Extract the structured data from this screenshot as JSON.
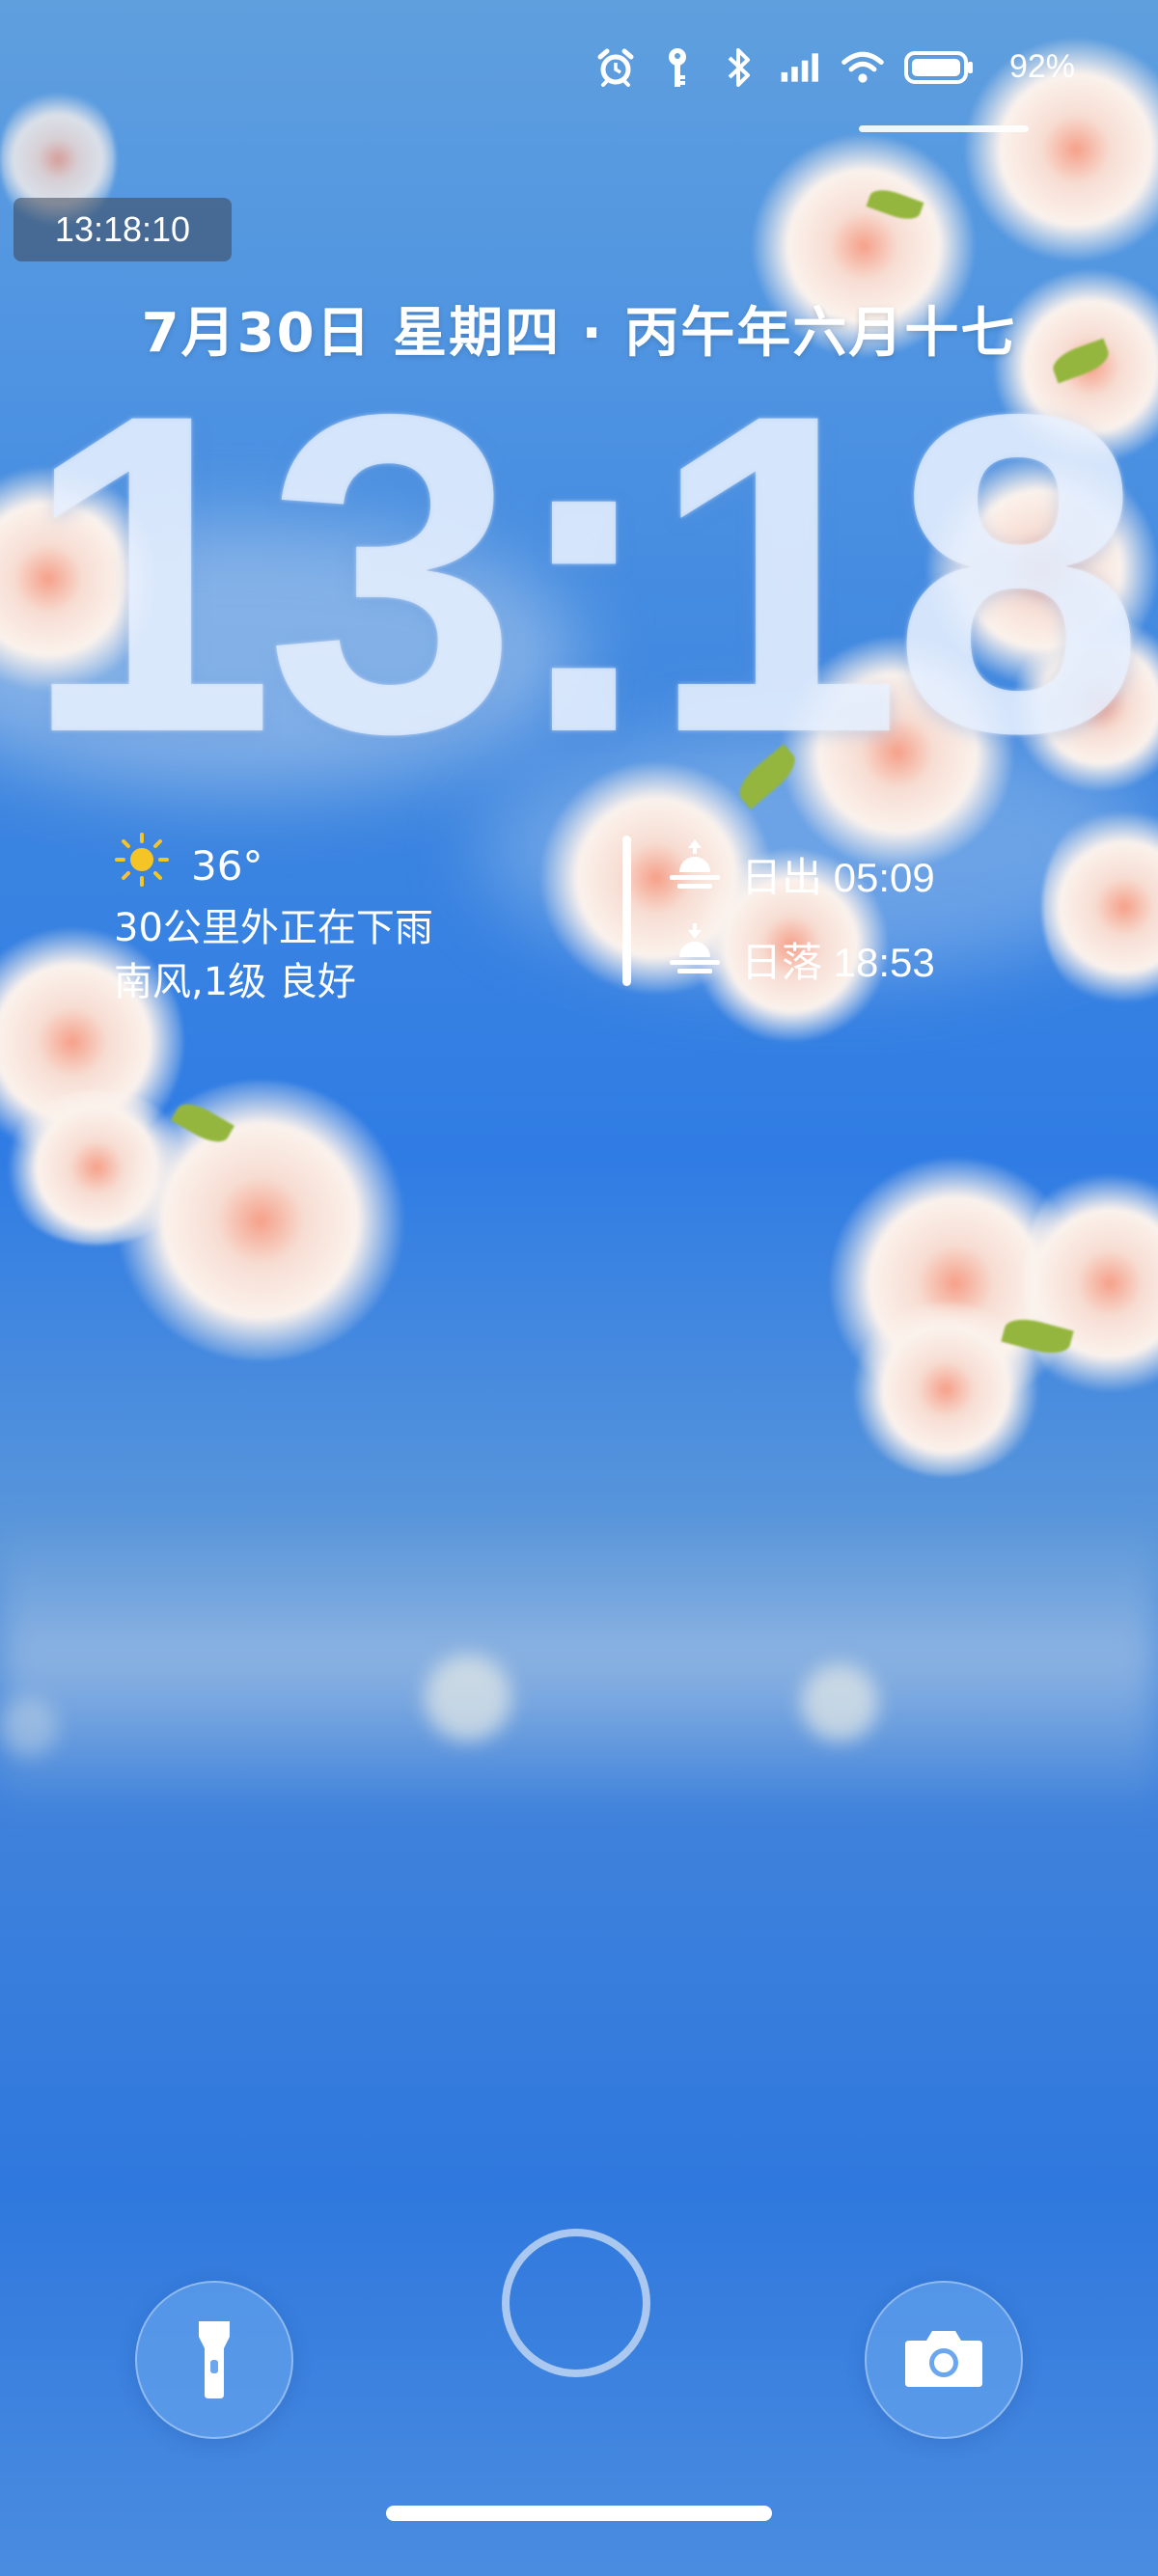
{
  "status_bar": {
    "icons": [
      "alarm-icon",
      "key-icon",
      "bluetooth-icon",
      "signal-icon",
      "wifi-icon",
      "battery-icon"
    ],
    "battery_percent": "92%"
  },
  "clock_chip": "13:18:10",
  "date_line": "7月30日 星期四 · 丙午年六月十七",
  "big_time": "13:18",
  "weather": {
    "icon": "sun-icon",
    "temperature": "36°",
    "line1": "30公里外正在下雨",
    "line2": "南风,1级 良好"
  },
  "sun_times": {
    "sunrise_label": "日出 05:09",
    "sunset_label": "日落 18:53"
  },
  "shortcuts": {
    "left": "flashlight-icon",
    "right": "camera-icon"
  },
  "colors": {
    "sky_top": "#5f9fde",
    "sky_bottom": "#2f78dd",
    "sun": "#f5c527"
  }
}
